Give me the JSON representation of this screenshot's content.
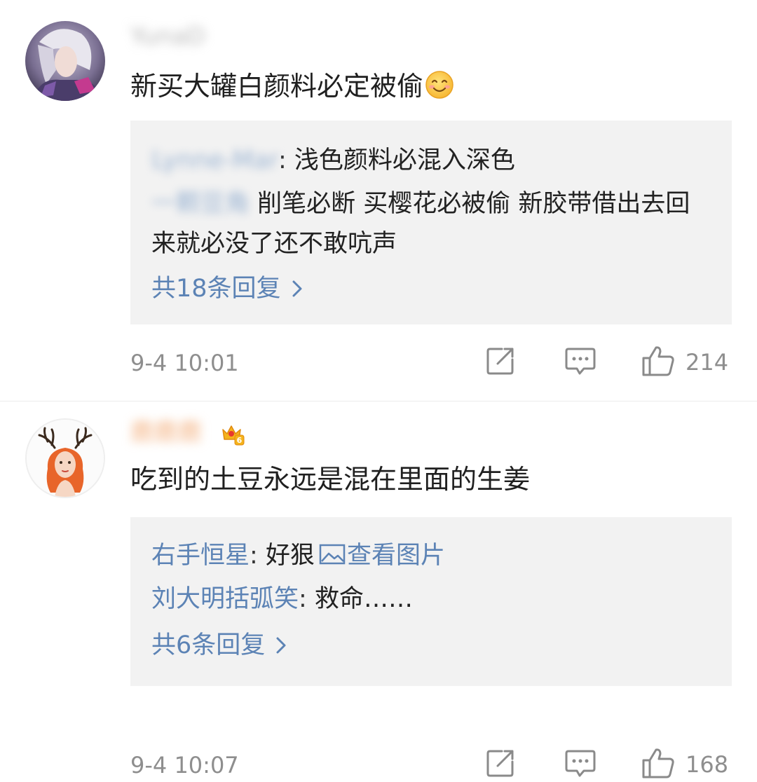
{
  "comments": [
    {
      "username": "YunaD",
      "text": "新买大罐白颜料必定被偷",
      "emoji_icon": "smile-emoji-icon",
      "replies": [
        {
          "user": "Lynne-Mar",
          "colon": ":",
          "text": "浅色颜料必混入深色"
        },
        {
          "user": "一颗豆角",
          "colon": "",
          "text": "削笔必断 买樱花必被偷 新胶带借出去回来就必没了还不敢吭声"
        }
      ],
      "more_replies": "共18条回复",
      "timestamp": "9-4 10:01",
      "likes": "214"
    },
    {
      "username": "鹿鹿鹿",
      "badge_icon": "vip-crown-icon",
      "badge_level": "6",
      "text": "吃到的土豆永远是混在里面的生姜",
      "replies": [
        {
          "user": "右手恒星",
          "colon": ":",
          "text": "好狠",
          "link": "查看图片"
        },
        {
          "user": "刘大明括弧笑",
          "colon": ":",
          "text": "救命……"
        }
      ],
      "more_replies": "共6条回复",
      "timestamp": "9-4 10:07",
      "likes": "168"
    }
  ],
  "colors": {
    "link_blue": "#5c83b5",
    "reply_bg": "#f2f2f2",
    "meta_gray": "#8e8e8e"
  }
}
